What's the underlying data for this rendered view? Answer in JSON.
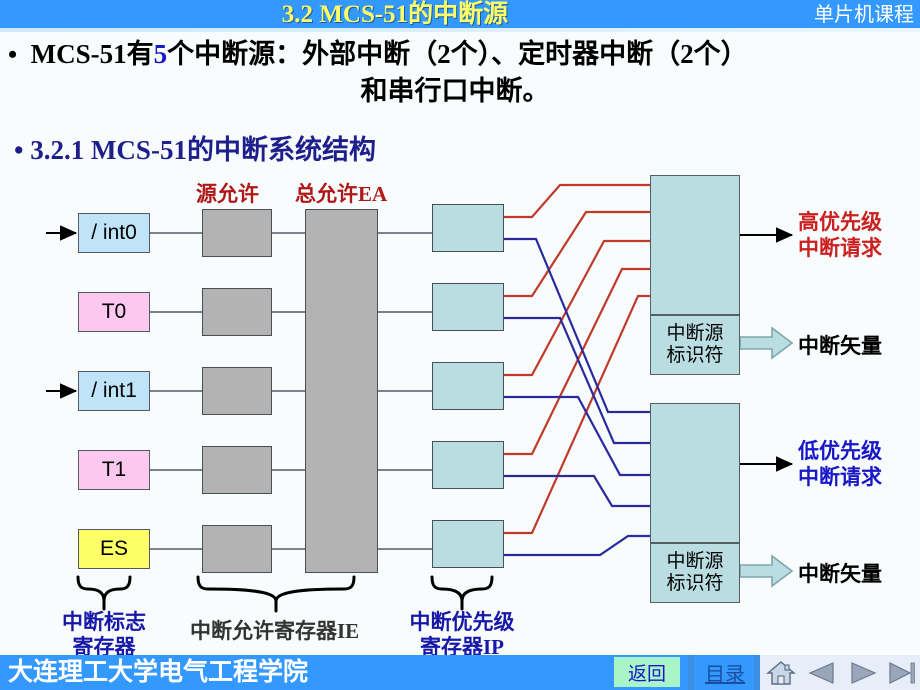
{
  "header": {
    "title": "3.2   MCS-51的中断源",
    "course": "单片机课程",
    "bg_color": "#3399ff",
    "title_color": "#ffff66"
  },
  "body": {
    "bullet_marker": "•",
    "line1_a": "MCS-51有",
    "line1_hl": "5",
    "line1_b": "个中断源：外部中断（2个）、定时器中断（2个）",
    "line2": "和串行口中断。",
    "subheading": "• 3.2.1  MCS-51的中断系统结构",
    "highlight_color": "#1818c8",
    "subheading_color": "#1f1f8c"
  },
  "diagram": {
    "column_labels": {
      "source_enable": "源允许",
      "global_enable": "总允许EA"
    },
    "sources": [
      {
        "name": "/ int0",
        "type": "ext",
        "color": "#bfe4f8",
        "has_input_arrow": true
      },
      {
        "name": "T0",
        "type": "timer",
        "color": "#fcc8ef",
        "has_input_arrow": false
      },
      {
        "name": "/ int1",
        "type": "ext",
        "color": "#bfe4f8",
        "has_input_arrow": true
      },
      {
        "name": "T1",
        "type": "timer",
        "color": "#fcc8ef",
        "has_input_arrow": false
      },
      {
        "name": "ES",
        "type": "serial",
        "color": "#ffff66",
        "has_input_arrow": false
      }
    ],
    "bracket_labels": [
      {
        "id": "flag-reg",
        "text_line1": "中断标志",
        "text_line2": "寄存器",
        "color": "#1818a8"
      },
      {
        "id": "ie-reg",
        "text_line1": "中断允许寄存器IE",
        "text_line2": "",
        "color": "#333333"
      },
      {
        "id": "ip-reg",
        "text_line1": "中断优先级",
        "text_line2": "寄存器IP",
        "color": "#1818a8"
      }
    ],
    "priority_blocks": [
      {
        "id": "high",
        "arrow_color": "#d98a8a",
        "identifier_line1": "中断源",
        "identifier_line2": "标识符",
        "request_line1": "高优先级",
        "request_line2": "中断请求",
        "request_color": "#cc2020",
        "vector_label": "中断矢量"
      },
      {
        "id": "low",
        "arrow_color": "#4a7fd6",
        "identifier_line1": "中断源",
        "identifier_line2": "标识符",
        "request_line1": "低优先级",
        "request_line2": "中断请求",
        "request_color": "#1818c8",
        "vector_label": "中断矢量"
      }
    ],
    "wire_colors": {
      "high_priority": "#c0392b",
      "low_priority": "#2a2a9e",
      "plain": "#555a62"
    },
    "box_fill": "#b9dde1",
    "switch_fill": "#b3b3b3"
  },
  "footer": {
    "school": "大连理工大学电气工程学院",
    "back_button": "返回",
    "index_link": "目录",
    "nav_icons": [
      "home-icon",
      "prev-icon",
      "next-icon",
      "last-icon"
    ],
    "bg_color": "#3399ff",
    "back_bg": "#aaf5c8"
  }
}
